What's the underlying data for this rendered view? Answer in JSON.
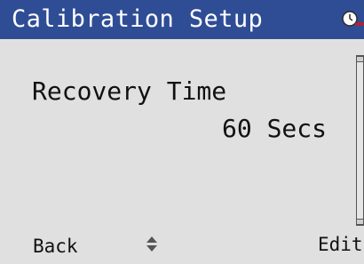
{
  "header": {
    "title": "Calibration Setup",
    "status_icon": "clock-alarm-icon"
  },
  "parameter": {
    "label": "Recovery Time",
    "value": "60 Secs"
  },
  "softkeys": {
    "left": "Back",
    "center_icon": "up-down-arrows-icon",
    "right": "Edit"
  },
  "colors": {
    "title_bar": "#2f4d95",
    "screen_background": "#e0e0e0",
    "alert_red": "#d01818"
  }
}
